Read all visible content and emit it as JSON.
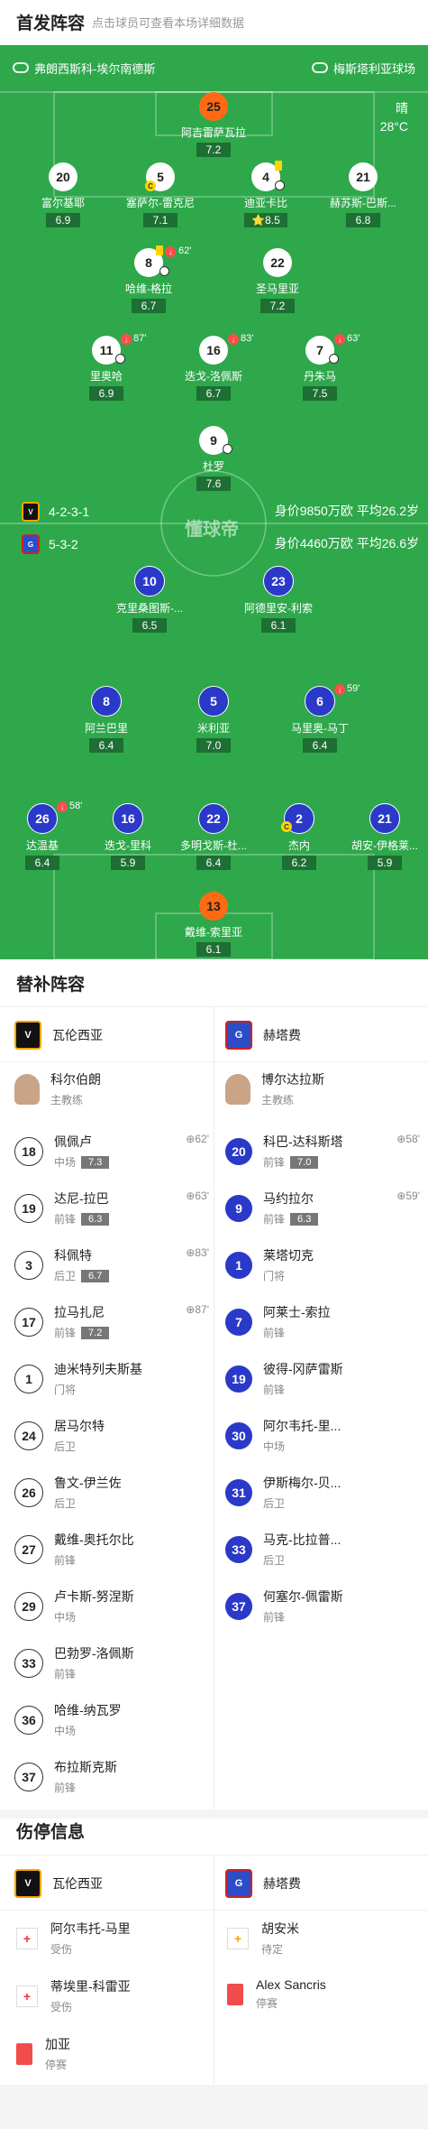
{
  "header": {
    "title": "首发阵容",
    "subtitle": "点击球员可查看本场详细数据"
  },
  "pitch": {
    "home_team": "弗朗西斯科-埃尔南德斯",
    "away_team": "梅斯塔利亚球场",
    "weather": "晴",
    "temperature": "28°C",
    "watermark": "懂球帝",
    "home_formation": "4-2-3-1",
    "home_value": "身价9850万欧 平均26.2岁",
    "away_formation": "5-3-2",
    "away_value": "身价4460万欧 平均26.6岁"
  },
  "home_players": [
    {
      "num": "25",
      "name": "阿吉雷萨瓦拉",
      "rating": "7.2"
    },
    {
      "num": "20",
      "name": "富尔基耶",
      "rating": "6.9"
    },
    {
      "num": "5",
      "name": "塞萨尔-雷克尼",
      "rating": "7.1"
    },
    {
      "num": "4",
      "name": "迪亚卡比",
      "rating": "8.5"
    },
    {
      "num": "21",
      "name": "赫苏斯-巴斯...",
      "rating": "6.8"
    },
    {
      "num": "8",
      "name": "哈维-格拉",
      "rating": "6.7",
      "event": "62'"
    },
    {
      "num": "22",
      "name": "圣马里亚",
      "rating": "7.2"
    },
    {
      "num": "11",
      "name": "里奥哈",
      "rating": "6.9",
      "event": "87'"
    },
    {
      "num": "16",
      "name": "迭戈-洛佩斯",
      "rating": "6.7",
      "event": "83'"
    },
    {
      "num": "7",
      "name": "丹朱马",
      "rating": "7.5",
      "event": "63'"
    },
    {
      "num": "9",
      "name": "杜罗",
      "rating": "7.6"
    }
  ],
  "away_players": [
    {
      "num": "10",
      "name": "克里桑图斯-...",
      "rating": "6.5"
    },
    {
      "num": "23",
      "name": "阿德里安-利索",
      "rating": "6.1"
    },
    {
      "num": "8",
      "name": "阿兰巴里",
      "rating": "6.4"
    },
    {
      "num": "5",
      "name": "米利亚",
      "rating": "7.0"
    },
    {
      "num": "6",
      "name": "马里奥-马丁",
      "rating": "6.4",
      "event": "59'"
    },
    {
      "num": "26",
      "name": "达温基",
      "rating": "6.4",
      "event": "58'"
    },
    {
      "num": "16",
      "name": "迭戈-里科",
      "rating": "5.9"
    },
    {
      "num": "22",
      "name": "多明戈斯-杜...",
      "rating": "6.4"
    },
    {
      "num": "2",
      "name": "杰内",
      "rating": "6.2"
    },
    {
      "num": "21",
      "name": "胡安-伊格莱...",
      "rating": "5.9"
    },
    {
      "num": "13",
      "name": "戴维-索里亚",
      "rating": "6.1"
    }
  ],
  "subs": {
    "title": "替补阵容",
    "home_team": "瓦伦西亚",
    "away_team": "赫塔费",
    "home_coach": {
      "name": "科尔伯朗",
      "role": "主教练"
    },
    "away_coach": {
      "name": "博尔达拉斯",
      "role": "主教练"
    },
    "home": [
      {
        "num": "18",
        "name": "佩佩卢",
        "pos": "中场",
        "rating": "7.3",
        "min": "62'"
      },
      {
        "num": "19",
        "name": "达尼-拉巴",
        "pos": "前锋",
        "rating": "6.3",
        "min": "63'"
      },
      {
        "num": "3",
        "name": "科佩特",
        "pos": "后卫",
        "rating": "6.7",
        "min": "83'"
      },
      {
        "num": "17",
        "name": "拉马扎尼",
        "pos": "前锋",
        "rating": "7.2",
        "min": "87'"
      },
      {
        "num": "1",
        "name": "迪米特列夫斯基",
        "pos": "门将"
      },
      {
        "num": "24",
        "name": "居马尔特",
        "pos": "后卫"
      },
      {
        "num": "26",
        "name": "鲁文-伊兰佐",
        "pos": "后卫"
      },
      {
        "num": "27",
        "name": "戴维-奥托尔比",
        "pos": "前锋"
      },
      {
        "num": "29",
        "name": "卢卡斯-努涅斯",
        "pos": "中场"
      },
      {
        "num": "33",
        "name": "巴勃罗-洛佩斯",
        "pos": "前锋"
      },
      {
        "num": "36",
        "name": "哈维-纳瓦罗",
        "pos": "中场"
      },
      {
        "num": "37",
        "name": "布拉斯克斯",
        "pos": "前锋"
      }
    ],
    "away": [
      {
        "num": "20",
        "name": "科巴-达科斯塔",
        "pos": "前锋",
        "rating": "7.0",
        "min": "58'"
      },
      {
        "num": "9",
        "name": "马约拉尔",
        "pos": "前锋",
        "rating": "6.3",
        "min": "59'"
      },
      {
        "num": "1",
        "name": "莱塔切克",
        "pos": "门将"
      },
      {
        "num": "7",
        "name": "阿莱士-索拉",
        "pos": "前锋"
      },
      {
        "num": "19",
        "name": "彼得-冈萨雷斯",
        "pos": "前锋"
      },
      {
        "num": "30",
        "name": "阿尔韦托-里...",
        "pos": "中场"
      },
      {
        "num": "31",
        "name": "伊斯梅尔-贝...",
        "pos": "后卫"
      },
      {
        "num": "33",
        "name": "马克-比拉普...",
        "pos": "后卫"
      },
      {
        "num": "37",
        "name": "何塞尔-佩雷斯",
        "pos": "前锋"
      }
    ]
  },
  "injuries": {
    "title": "伤停信息",
    "home_team": "瓦伦西亚",
    "away_team": "赫塔费",
    "home": [
      {
        "name": "阿尔韦托-马里",
        "status": "受伤",
        "type": "injury"
      },
      {
        "name": "蒂埃里-科雷亚",
        "status": "受伤",
        "type": "injury"
      },
      {
        "name": "加亚",
        "status": "停赛",
        "type": "suspension"
      }
    ],
    "away": [
      {
        "name": "胡安米",
        "status": "待定",
        "type": "doubt"
      },
      {
        "name": "Alex Sancris",
        "status": "停赛",
        "type": "suspension"
      }
    ]
  }
}
